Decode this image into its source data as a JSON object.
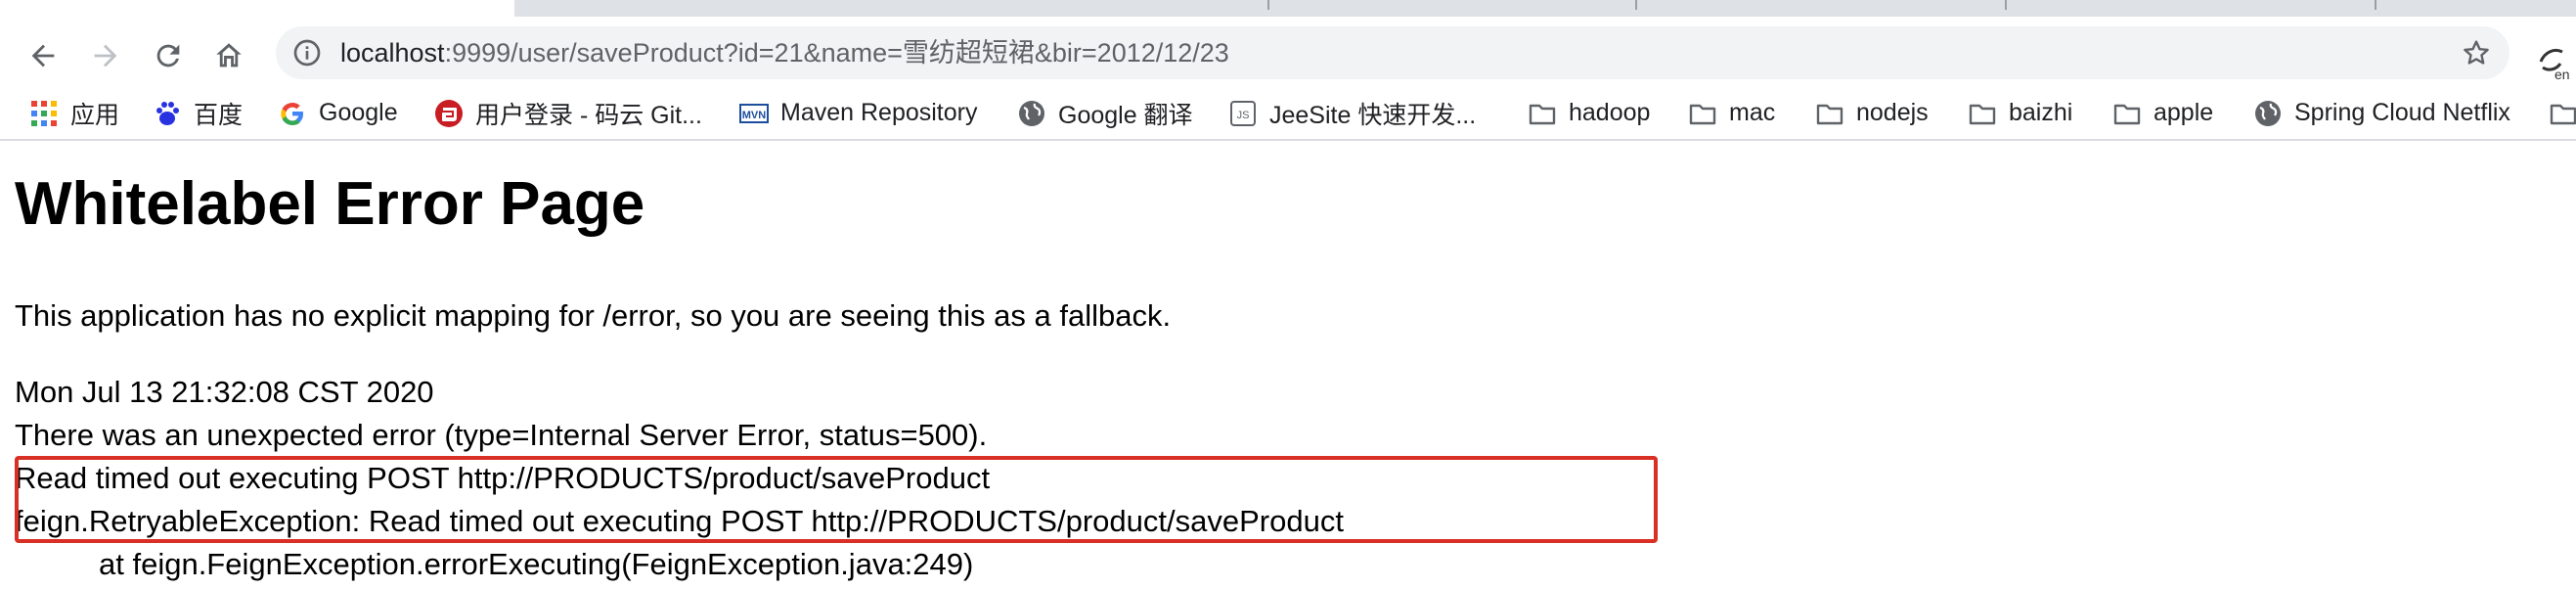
{
  "browser": {
    "url": {
      "host": "localhost",
      "path": ":9999/user/saveProduct?id=21&name=雪纺超短裙&bir=2012/12/23"
    },
    "nav_icons": [
      "back-arrow-icon",
      "forward-arrow-icon",
      "reload-icon",
      "home-icon"
    ],
    "omnibox_icons": [
      "info-icon",
      "star-icon"
    ],
    "extension_icon": "translate-extension-icon"
  },
  "bookmarks": [
    {
      "label": "应用",
      "icon": "apps-grid-icon"
    },
    {
      "label": "百度",
      "icon": "baidu-paw-icon"
    },
    {
      "label": "Google",
      "icon": "google-g-icon"
    },
    {
      "label": "用户登录 - 码云 Git...",
      "icon": "gitee-icon"
    },
    {
      "label": "Maven Repository",
      "icon": "maven-icon"
    },
    {
      "label": "Google 翻译",
      "icon": "globe-icon"
    },
    {
      "label": "JeeSite 快速开发...",
      "icon": "js-icon"
    },
    {
      "label": "hadoop",
      "icon": "folder-icon"
    },
    {
      "label": "mac",
      "icon": "folder-icon"
    },
    {
      "label": "nodejs",
      "icon": "folder-icon"
    },
    {
      "label": "baizhi",
      "icon": "folder-icon"
    },
    {
      "label": "apple",
      "icon": "folder-icon"
    },
    {
      "label": "Spring Cloud Netflix",
      "icon": "globe-icon"
    }
  ],
  "error_page": {
    "title": "Whitelabel Error Page",
    "description": "This application has no explicit mapping for /error, so you are seeing this as a fallback.",
    "timestamp": "Mon Jul 13 21:32:08 CST 2020",
    "status_line": "There was an unexpected error (type=Internal Server Error, status=500).",
    "message": "Read timed out executing POST http://PRODUCTS/product/saveProduct",
    "exception": "feign.RetryableException: Read timed out executing POST http://PRODUCTS/product/saveProduct",
    "stack_line": "at feign.FeignException.errorExecuting(FeignException.java:249)"
  },
  "colors": {
    "highlight_border": "#d93025",
    "toolbar_icon": "#5f6368",
    "omnibox_bg": "#f1f3f4"
  }
}
